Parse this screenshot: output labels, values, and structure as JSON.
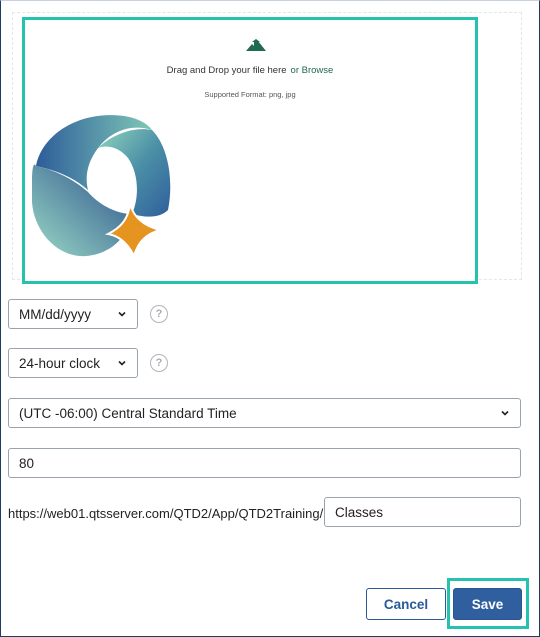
{
  "upload": {
    "drag_text": "Drag and Drop your file here",
    "browse_label": "or Browse",
    "formats_text": "Supported Format: png, jpg"
  },
  "date_format": {
    "selected": "MM/dd/yyyy"
  },
  "time_format": {
    "selected": "24-hour clock"
  },
  "timezone": {
    "selected": "(UTC -06:00) Central Standard Time"
  },
  "numeric_field": {
    "value": "80"
  },
  "url": {
    "prefix": "https://web01.qtsserver.com/QTD2/App/QTD2Training/",
    "suffix_value": "Classes"
  },
  "help": {
    "symbol": "?"
  },
  "actions": {
    "cancel_label": "Cancel",
    "save_label": "Save"
  },
  "colors": {
    "highlight": "#25c2ae",
    "primary": "#2f5f9f",
    "link": "#1e6a52"
  }
}
